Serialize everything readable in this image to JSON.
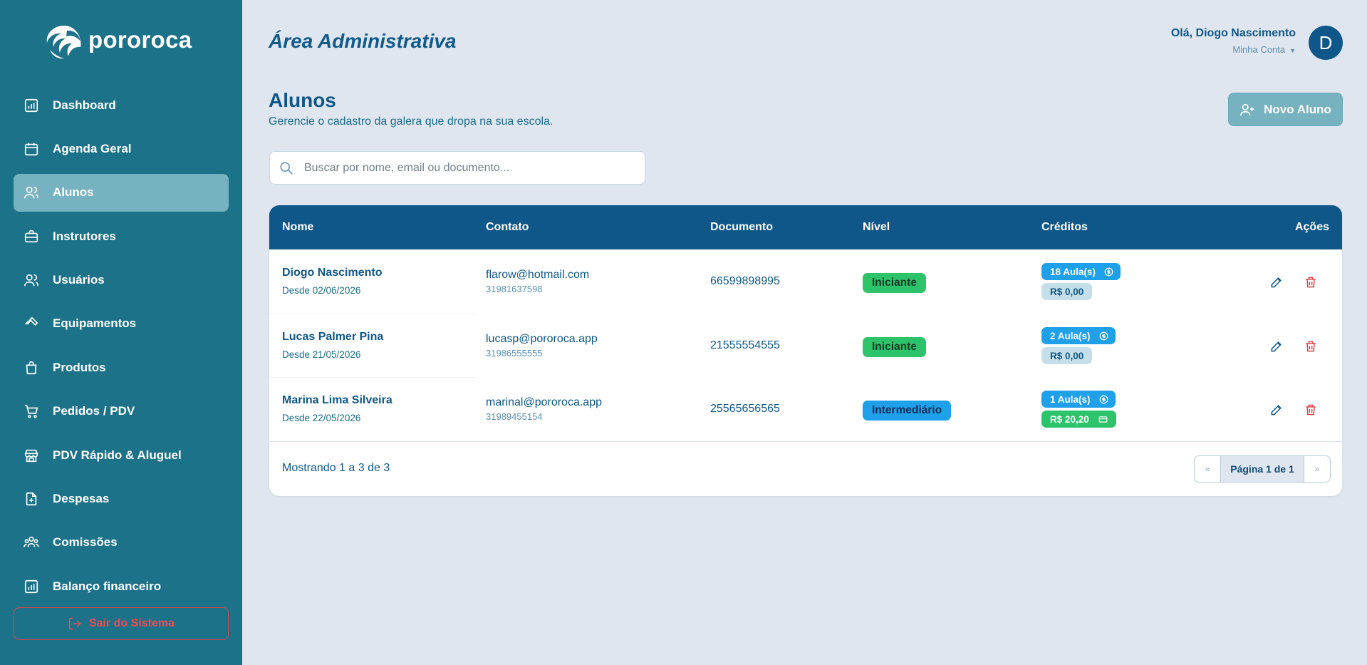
{
  "app": {
    "logo_text": "pororoca"
  },
  "sidebar": {
    "items": [
      {
        "label": "Dashboard",
        "icon": "chart-icon",
        "active": false
      },
      {
        "label": "Agenda Geral",
        "icon": "calendar-icon",
        "active": false
      },
      {
        "label": "Alunos",
        "icon": "users-icon",
        "active": true
      },
      {
        "label": "Instrutores",
        "icon": "briefcase-icon",
        "active": false
      },
      {
        "label": "Usuários",
        "icon": "users-icon",
        "active": false
      },
      {
        "label": "Equipamentos",
        "icon": "wrench-icon",
        "active": false
      },
      {
        "label": "Produtos",
        "icon": "bag-icon",
        "active": false
      },
      {
        "label": "Pedidos / PDV",
        "icon": "cart-icon",
        "active": false
      },
      {
        "label": "PDV Rápido & Aluguel",
        "icon": "store-icon",
        "active": false
      },
      {
        "label": "Despesas",
        "icon": "file-plus-icon",
        "active": false
      },
      {
        "label": "Comissões",
        "icon": "group-icon",
        "active": false
      },
      {
        "label": "Balanço financeiro",
        "icon": "chart-icon",
        "active": false
      }
    ],
    "logout_label": "Sair do Sistema"
  },
  "header": {
    "area_title": "Área Administrativa",
    "greeting": "Olá, Diogo Nascimento",
    "account_label": "Minha Conta",
    "avatar_initial": "D"
  },
  "page": {
    "title": "Alunos",
    "subtitle": "Gerencie o cadastro da galera que dropa na sua escola.",
    "new_button": "Novo Aluno"
  },
  "search": {
    "placeholder": "Buscar por nome, email ou documento...",
    "value": ""
  },
  "table": {
    "columns": [
      "Nome",
      "Contato",
      "Documento",
      "Nível",
      "Créditos",
      "Ações"
    ],
    "rows": [
      {
        "name": "Diogo Nascimento",
        "since": "Desde 02/06/2026",
        "email": "flarow@hotmail.com",
        "phone": "31981637598",
        "document": "66599898995",
        "level": "Iniciante",
        "lessons": "18 Aula(s)",
        "balance": "R$ 0,00"
      },
      {
        "name": "Lucas Palmer Pina",
        "since": "Desde 21/05/2026",
        "email": "lucasp@pororoca.app",
        "phone": "31986555555",
        "document": "21555554555",
        "level": "Iniciante",
        "lessons": "2 Aula(s)",
        "balance": "R$ 0,00"
      },
      {
        "name": "Marina Lima Silveira",
        "since": "Desde 22/05/2026",
        "email": "marinal@pororoca.app",
        "phone": "31989455154",
        "document": "25565656565",
        "level": "Intermediário",
        "lessons": "1 Aula(s)",
        "balance": "R$ 20,20"
      }
    ],
    "showing": "Mostrando 1 a 3 de 3",
    "pagination": {
      "prev": "«",
      "current": "Página 1 de 1",
      "next": "»"
    }
  },
  "colors": {
    "sidebar": "#1c7289",
    "primary": "#0f5788",
    "active_item": "#76b2c0",
    "level_iniciante": "#2cc36b",
    "level_intermediario": "#1ea0ea",
    "danger": "#e0424a"
  }
}
